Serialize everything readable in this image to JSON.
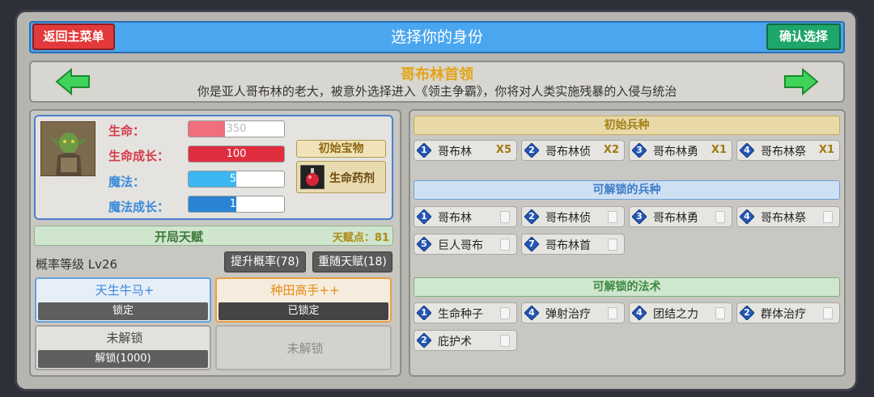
{
  "header": {
    "back_label": "返回主菜单",
    "title": "选择你的身份",
    "confirm_label": "确认选择",
    "accent_color": "#4aa6ee"
  },
  "identity": {
    "name": "哥布林首领",
    "description": "你是亚人哥布林的老大，被意外选择进入《领主争霸》，你将对人类实施残暴的入侵与统治",
    "prev_icon": "arrow-left-icon",
    "next_icon": "arrow-right-icon"
  },
  "stats": {
    "hp_label": "生命：",
    "hp_value": "350",
    "hp_fill": 0.38,
    "hp_growth_label": "生命成长：",
    "hp_growth_value": "100",
    "hp_growth_fill": 1.0,
    "mp_label": "魔法：",
    "mp_value": "50",
    "mp_fill": 0.5,
    "mp_growth_label": "魔法成长：",
    "mp_growth_value": "10",
    "mp_growth_fill": 0.5,
    "treasure_label": "初始宝物",
    "treasure_name": "生命药剂",
    "treasure_icon": "potion-icon"
  },
  "talent": {
    "header": "开局天赋",
    "points": "天赋点：81",
    "prob_level": "概率等级 Lv26",
    "raise_prob_label": "提升概率(78)",
    "reroll_label": "重随天赋(18)",
    "cards": [
      {
        "name": "天生牛马+",
        "status": "锁定"
      },
      {
        "name": "种田高手++",
        "status": "已锁定"
      },
      {
        "name": "未解锁",
        "status": "解锁(1000)"
      },
      {
        "name": "未解锁"
      }
    ]
  },
  "initial_troops": {
    "header": "初始兵种",
    "items": [
      {
        "level": "1",
        "name": "哥布林",
        "count": "X5"
      },
      {
        "level": "2",
        "name": "哥布林侦",
        "count": "X2"
      },
      {
        "level": "3",
        "name": "哥布林勇",
        "count": "X1"
      },
      {
        "level": "4",
        "name": "哥布林祭",
        "count": "X1"
      }
    ]
  },
  "unlockable_troops": {
    "header": "可解锁的兵种",
    "items": [
      {
        "level": "1",
        "name": "哥布林"
      },
      {
        "level": "2",
        "name": "哥布林侦"
      },
      {
        "level": "3",
        "name": "哥布林勇"
      },
      {
        "level": "4",
        "name": "哥布林祭"
      },
      {
        "level": "5",
        "name": "巨人哥布"
      },
      {
        "level": "7",
        "name": "哥布林首"
      }
    ]
  },
  "unlockable_spells": {
    "header": "可解锁的法术",
    "items": [
      {
        "level": "1",
        "name": "生命种子"
      },
      {
        "level": "4",
        "name": "弹射治疗"
      },
      {
        "level": "4",
        "name": "团结之力"
      },
      {
        "level": "2",
        "name": "群体治疗"
      },
      {
        "level": "2",
        "name": "庇护术"
      }
    ]
  }
}
